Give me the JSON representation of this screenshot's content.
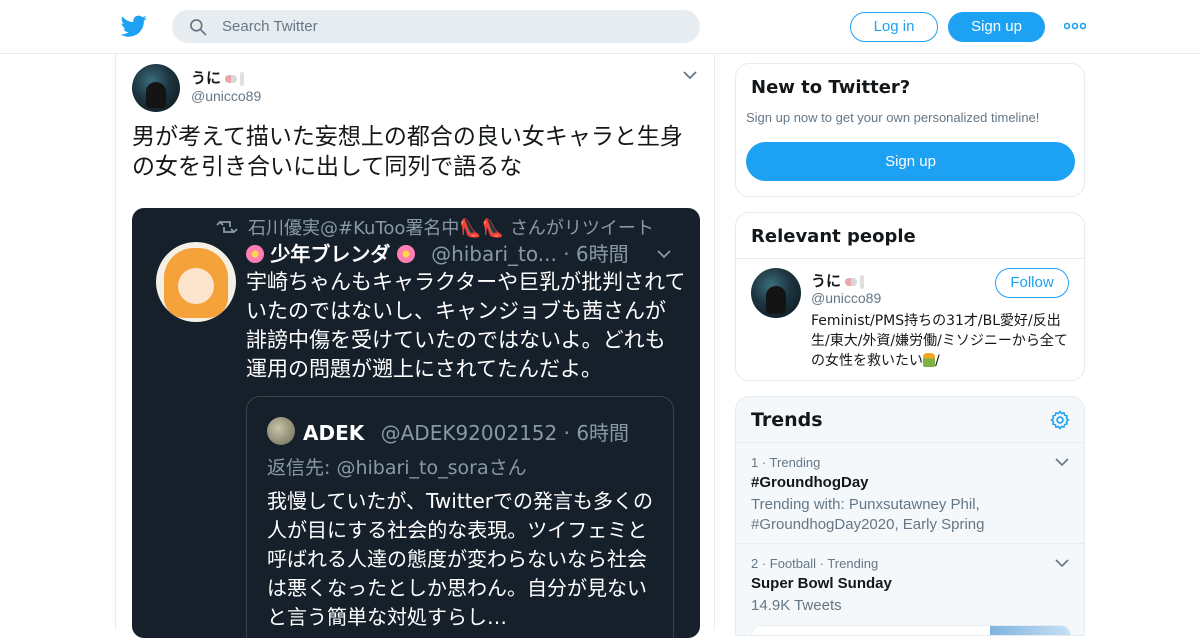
{
  "header": {
    "search_placeholder": "Search Twitter",
    "login_label": "Log in",
    "signup_label": "Sign up"
  },
  "tweet": {
    "display_name": "うに",
    "handle": "@unicco89",
    "text": "男が考えて描いた妄想上の都合の良い女キャラと生身の女を引き合いに出して同列で語るな",
    "media": {
      "retweeted_by": "石川優実@#KuToo署名中👠👠 さんがリツイート",
      "author_name": "少年ブレンダ",
      "author_handle_time": "@hibari_to... · 6時間",
      "text": "宇崎ちゃんもキャラクターや巨乳が批判されていたのではないし、キャンジョブも茜さんが誹謗中傷を受けていたのではないよ。どれも運用の問題が遡上にされてたんだよ。",
      "quote": {
        "author_name": "ADEK",
        "author_handle_time": "@ADEK92002152 · 6時間",
        "reply_to": "返信先: @hibari_to_soraさん",
        "text": "我慢していたが、Twitterでの発言も多くの人が目にする社会的な表現。ツイフェミと呼ばれる人達の態度が変わらないなら社会は悪くなったとしか思わん。自分が見ないと言う簡単な対処すらし…"
      }
    }
  },
  "sidebar": {
    "new_to_twitter": {
      "title": "New to Twitter?",
      "subtitle": "Sign up now to get your own personalized timeline!",
      "signup_label": "Sign up"
    },
    "relevant_people": {
      "title": "Relevant people",
      "person": {
        "name": "うに",
        "handle": "@unicco89",
        "follow_label": "Follow",
        "bio": "Feminist/PMS持ちの31才/BL愛好/反出生/東大/外資/嫌労働/ミソジニーから全ての女性を救いたい",
        "bio_end": "/"
      }
    },
    "trends": {
      "title": "Trends",
      "items": [
        {
          "meta": "1 · Trending",
          "name": "#GroundhogDay",
          "extra": "Trending with: Punxsutawney Phil, #GroundhogDay2020, Early Spring"
        },
        {
          "meta": "2 · Football · Trending",
          "name": "Super Bowl Sunday",
          "extra": "14.9K Tweets"
        }
      ]
    }
  },
  "colors": {
    "accent": "#1da1f2",
    "media_bg": "#15202b",
    "muted": "#657786"
  },
  "icons": {
    "logo": "twitter-bird-icon",
    "search": "search-icon",
    "more": "more-dots-icon",
    "caret": "chevron-down-icon",
    "settings": "gear-icon",
    "retweet": "retweet-icon"
  }
}
